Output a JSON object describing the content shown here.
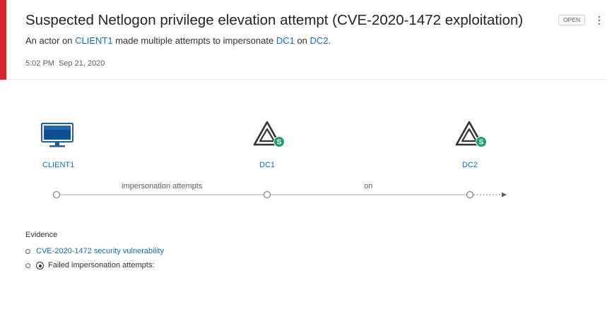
{
  "alert": {
    "title": "Suspected Netlogon privilege elevation attempt (CVE-2020-1472 exploitation)",
    "status": "OPEN",
    "severity_color": "#d8232a",
    "description": {
      "prefix": "An actor on ",
      "actor": "CLIENT1",
      "middle": " made multiple attempts to impersonate ",
      "target1": "DC1",
      "connector": " on ",
      "target2": "DC2",
      "suffix": "."
    },
    "time": "5:02 PM",
    "date": "Sep 21, 2020",
    "more_icon": "more-vertical-icon"
  },
  "entities": [
    {
      "name": "CLIENT1",
      "icon": "computer-icon"
    },
    {
      "name": "DC1",
      "icon": "domain-controller-icon",
      "badge": "S"
    },
    {
      "name": "DC2",
      "icon": "domain-controller-icon",
      "badge": "S"
    }
  ],
  "edges": {
    "first": "impersonation attempts",
    "second": "on"
  },
  "evidence": {
    "title": "Evidence",
    "items": [
      {
        "text": "CVE-2020-1472 security vulnerability",
        "link": true
      },
      {
        "text": "Failed impersonation attempts:",
        "expandable": true
      }
    ]
  },
  "colors": {
    "link": "#0f6cbd",
    "badge": "#1aa06b"
  }
}
